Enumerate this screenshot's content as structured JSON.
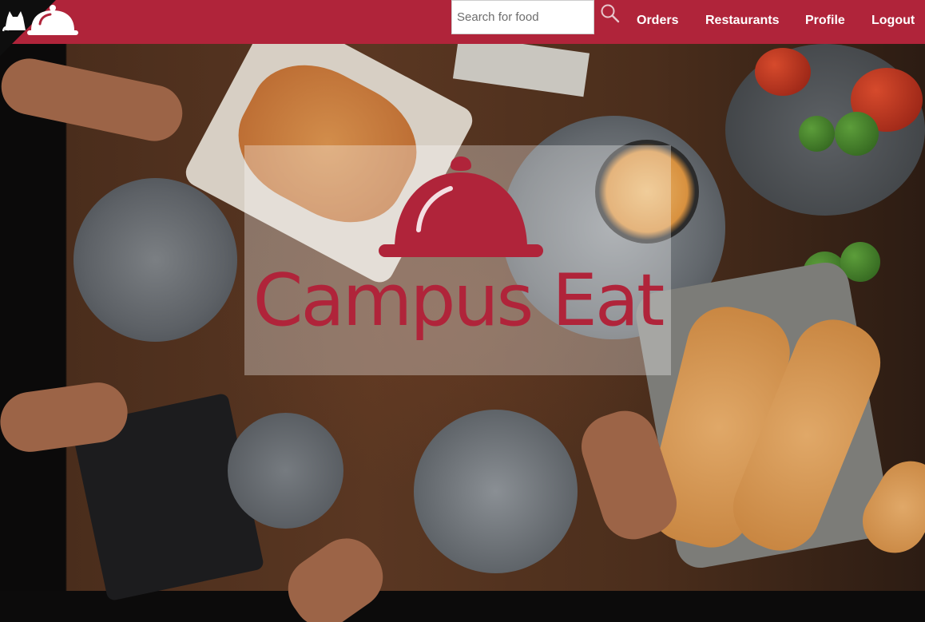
{
  "app": {
    "brand": "Campus Eat",
    "brand_color": "#b0243a",
    "logo_icon": "cloche-icon",
    "corner_icon": "cat-icon"
  },
  "search": {
    "placeholder": "Search for food",
    "value": "",
    "icon": "search-icon"
  },
  "nav": {
    "orders": "Orders",
    "restaurants": "Restaurants",
    "profile": "Profile",
    "logout": "Logout"
  },
  "hero": {
    "title": "Campus Eat"
  }
}
